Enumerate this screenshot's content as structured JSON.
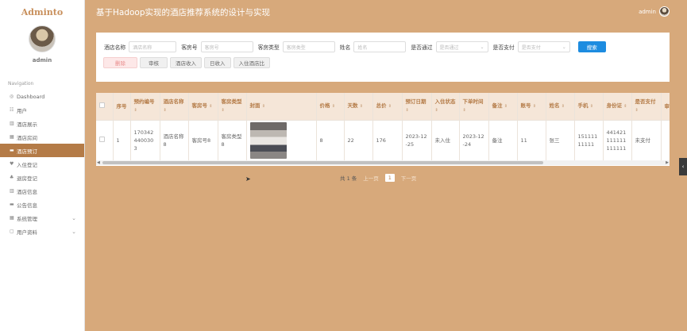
{
  "app": {
    "logo": "Adminto",
    "title": "基于Hadoop实现的酒店推荐系统的设计与实现",
    "user": "admin"
  },
  "sidebar": {
    "username": "admin",
    "nav_heading": "Navigation",
    "items": [
      {
        "label": "Dashboard",
        "icon": "dashboard-icon",
        "glyph": "◎"
      },
      {
        "label": "用户",
        "icon": "user-icon",
        "glyph": "☷"
      },
      {
        "label": "酒店展示",
        "icon": "hotel-icon",
        "glyph": "▥"
      },
      {
        "label": "酒店房间",
        "icon": "room-icon",
        "glyph": "▦"
      },
      {
        "label": "酒店预订",
        "icon": "booking-icon",
        "glyph": "▬",
        "active": true
      },
      {
        "label": "入住登记",
        "icon": "checkin-icon",
        "glyph": "♥"
      },
      {
        "label": "退房登记",
        "icon": "checkout-icon",
        "glyph": "♣"
      },
      {
        "label": "酒店信息",
        "icon": "info-icon",
        "glyph": "▥"
      },
      {
        "label": "公告信息",
        "icon": "notice-icon",
        "glyph": "▬"
      },
      {
        "label": "系统管理",
        "icon": "system-icon",
        "glyph": "▦",
        "expandable": true
      },
      {
        "label": "用户资料",
        "icon": "profile-icon",
        "glyph": "▢",
        "expandable": true
      }
    ]
  },
  "search": {
    "fields": [
      {
        "label": "酒店名称",
        "placeholder": "酒店名称",
        "width": 60
      },
      {
        "label": "客房号",
        "placeholder": "客房号",
        "width": 66
      },
      {
        "label": "客房类型",
        "placeholder": "客房类型",
        "width": 66
      },
      {
        "label": "姓名",
        "placeholder": "姓名",
        "width": 66
      }
    ],
    "selects": [
      {
        "label": "是否通过",
        "placeholder": "是否通过"
      },
      {
        "label": "是否支付",
        "placeholder": "是否支付"
      }
    ],
    "search_button": "搜索",
    "actions": [
      "删除",
      "审核",
      "酒店收入",
      "日收入",
      "入住酒店比"
    ]
  },
  "table": {
    "columns": [
      "序号",
      "预约编号",
      "酒店名称",
      "客房号",
      "客房类型",
      "封面",
      "价格",
      "天数",
      "总价",
      "预订日期",
      "入住状态",
      "下单时间",
      "备注",
      "账号",
      "姓名",
      "手机",
      "身份证",
      "是否支付",
      "审核"
    ],
    "rows": [
      {
        "index": "1",
        "booking_no": "1703424400303",
        "hotel_name": "酒店名称8",
        "room_no": "客房号8",
        "room_type": "客房类型8",
        "price": "8",
        "days": "22",
        "total": "176",
        "booking_date": "2023-12-25",
        "checkin_status": "未入住",
        "order_time": "2023-12-24",
        "remark": "备注",
        "account": "11",
        "name": "张三",
        "phone": "15111111111",
        "id_card": "441421111111111111",
        "paid": "未支付",
        "audit": ""
      }
    ]
  },
  "pager": {
    "total": "共 1 条",
    "prev": "上一页",
    "current": "1",
    "next": "下一页"
  },
  "colors": {
    "accent": "#b47b47",
    "background": "#d7a97b",
    "header": "#f5e6d8",
    "primary_button": "#1d8ce0"
  }
}
